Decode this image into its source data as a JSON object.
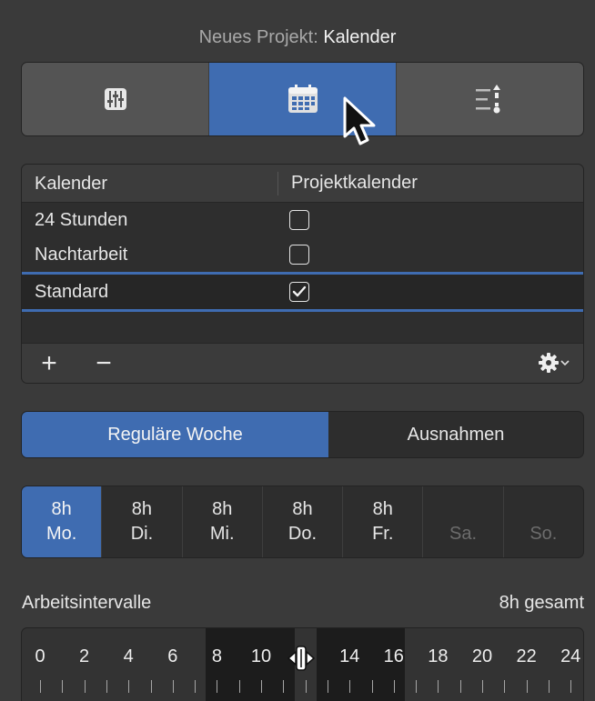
{
  "header": {
    "title_prefix": "Neues Projekt:",
    "title_main": "Kalender"
  },
  "tabs": [
    {
      "icon": "sliders-icon",
      "active": false
    },
    {
      "icon": "calendar-icon",
      "active": true
    },
    {
      "icon": "sort-list-icon",
      "active": false
    }
  ],
  "calendar_table": {
    "columns": [
      "Kalender",
      "Projektkalender"
    ],
    "rows": [
      {
        "name": "24 Stunden",
        "checked": false
      },
      {
        "name": "Nachtarbeit",
        "checked": false
      },
      {
        "name": "Standard",
        "checked": true,
        "selected": true
      }
    ],
    "add_label": "+",
    "remove_label": "−",
    "action_icon": "gear-icon"
  },
  "week_toggle": {
    "regular_label": "Reguläre Woche",
    "exceptions_label": "Ausnahmen",
    "active": "regular"
  },
  "days": [
    {
      "hours": "8h",
      "label": "Mo.",
      "state": "active"
    },
    {
      "hours": "8h",
      "label": "Di.",
      "state": "on"
    },
    {
      "hours": "8h",
      "label": "Mi.",
      "state": "on"
    },
    {
      "hours": "8h",
      "label": "Do.",
      "state": "on"
    },
    {
      "hours": "8h",
      "label": "Fr.",
      "state": "on"
    },
    {
      "hours": "",
      "label": "Sa.",
      "state": "off"
    },
    {
      "hours": "",
      "label": "So.",
      "state": "off"
    }
  ],
  "intervals": {
    "label": "Arbeitsintervalle",
    "total": "8h gesamt",
    "tick_labels": [
      "0",
      "2",
      "4",
      "6",
      "8",
      "10",
      "12",
      "14",
      "16",
      "18",
      "20",
      "22",
      "24"
    ],
    "work_blocks_hours": [
      [
        8,
        12
      ],
      [
        13,
        17
      ]
    ]
  },
  "colors": {
    "accent": "#3f6cb1",
    "panel": "#3a3a3a"
  }
}
